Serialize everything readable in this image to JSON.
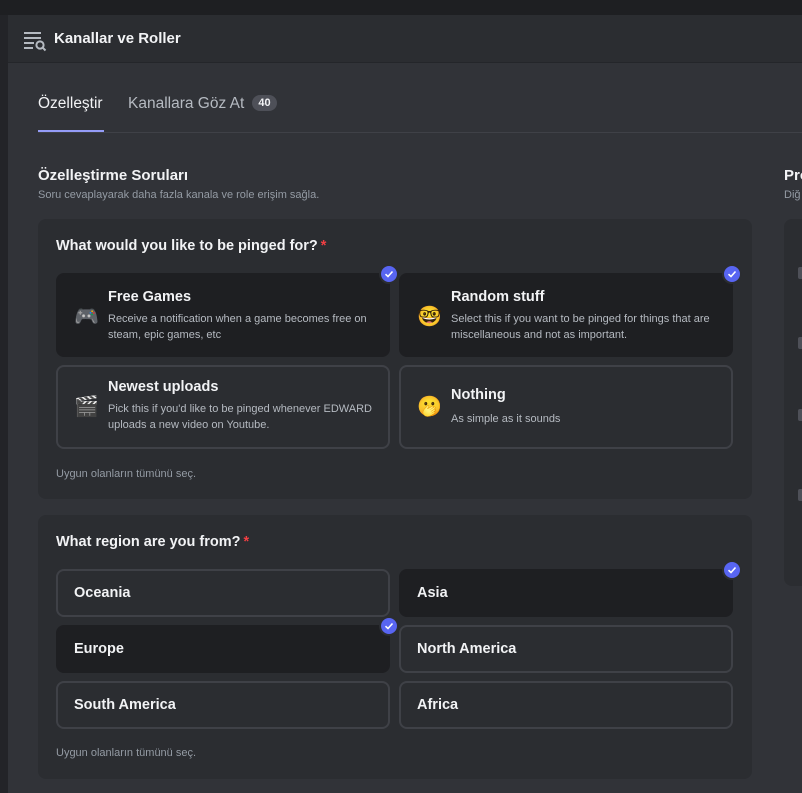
{
  "header": {
    "title": "Kanallar ve Roller",
    "icon": "channels-browse-icon"
  },
  "tabs": [
    {
      "label": "Özelleştir",
      "active": true
    },
    {
      "label": "Kanallara Göz At",
      "active": false,
      "badge": "40"
    }
  ],
  "section": {
    "title": "Özelleştirme Soruları",
    "subtitle": "Soru cevaplayarak daha fazla kanala ve role erişim sağla."
  },
  "right_section": {
    "title": "Pro",
    "subtitle": "Diğ"
  },
  "questions": [
    {
      "title": "What would you like to be pinged for?",
      "required": "*",
      "select_all": "Uygun olanların tümünü seç.",
      "options": [
        {
          "emoji": "🎮",
          "icon": "game-controller-icon",
          "title": "Free Games",
          "description": "Receive a notification when a game becomes free on steam, epic games, etc",
          "selected": true
        },
        {
          "emoji": "🤓",
          "icon": "nerd-face-icon",
          "title": "Random stuff",
          "description": "Select this if you want to be pinged for things that are miscellaneous and not as important.",
          "selected": true
        },
        {
          "emoji": "🎬",
          "icon": "clapper-board-icon",
          "title": "Newest uploads",
          "description": "Pick this if you'd like to be pinged whenever EDWARD uploads a new video on Youtube.",
          "selected": false
        },
        {
          "emoji": "🫢",
          "icon": "face-hand-over-mouth-icon",
          "title": "Nothing",
          "description": "As simple as it sounds",
          "selected": false
        }
      ]
    },
    {
      "title": "What region are you from?",
      "required": "*",
      "select_all": "Uygun olanların tümünü seç.",
      "options": [
        {
          "label": "Oceania",
          "selected": false
        },
        {
          "label": "Asia",
          "selected": true
        },
        {
          "label": "Europe",
          "selected": true
        },
        {
          "label": "North America",
          "selected": false
        },
        {
          "label": "South America",
          "selected": false
        },
        {
          "label": "Africa",
          "selected": false
        }
      ]
    }
  ],
  "colors": {
    "accent": "#5865f2",
    "required": "#f23f43",
    "tab_underline": "#949cf7"
  }
}
